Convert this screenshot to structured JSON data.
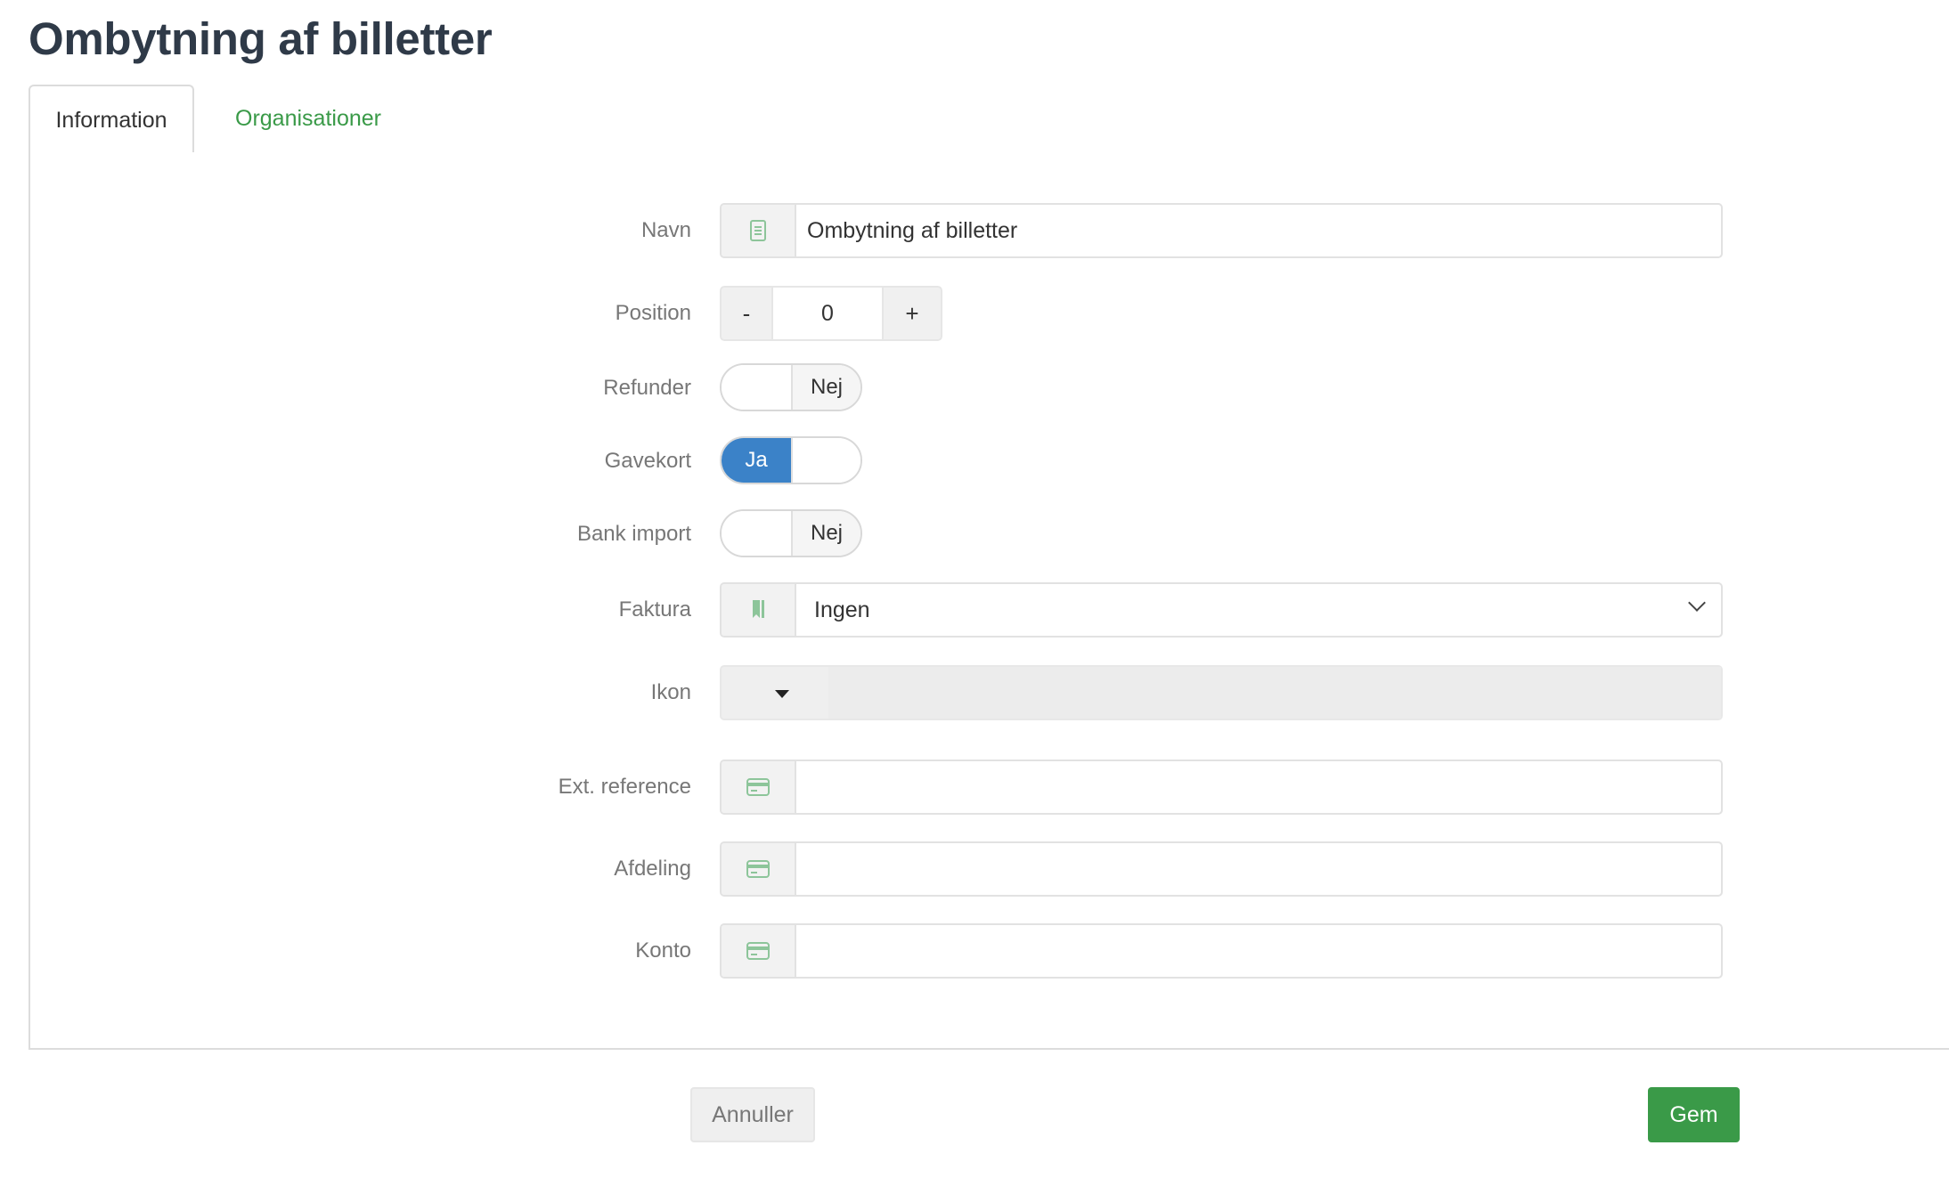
{
  "page": {
    "title": "Ombytning af billetter"
  },
  "tabs": [
    {
      "label": "Information",
      "active": true
    },
    {
      "label": "Organisationer",
      "active": false
    }
  ],
  "form": {
    "navn": {
      "label": "Navn",
      "value": "Ombytning af billetter",
      "icon": "document-icon"
    },
    "position": {
      "label": "Position",
      "value": "0",
      "minus": "-",
      "plus": "+"
    },
    "refunder": {
      "label": "Refunder",
      "state": "Nej"
    },
    "gavekort": {
      "label": "Gavekort",
      "state": "Ja"
    },
    "bank_import": {
      "label": "Bank import",
      "state": "Nej"
    },
    "faktura": {
      "label": "Faktura",
      "value": "Ingen",
      "icon": "bookmark-icon"
    },
    "ikon": {
      "label": "Ikon"
    },
    "ext_reference": {
      "label": "Ext. reference",
      "value": "",
      "icon": "credit-card-icon"
    },
    "afdeling": {
      "label": "Afdeling",
      "value": "",
      "icon": "credit-card-icon"
    },
    "konto": {
      "label": "Konto",
      "value": "",
      "icon": "credit-card-icon"
    }
  },
  "buttons": {
    "cancel": "Annuller",
    "save": "Gem"
  },
  "colors": {
    "accent_green": "#3a9a48",
    "toggle_blue": "#3b82c8",
    "icon_green": "#8dc59a"
  }
}
